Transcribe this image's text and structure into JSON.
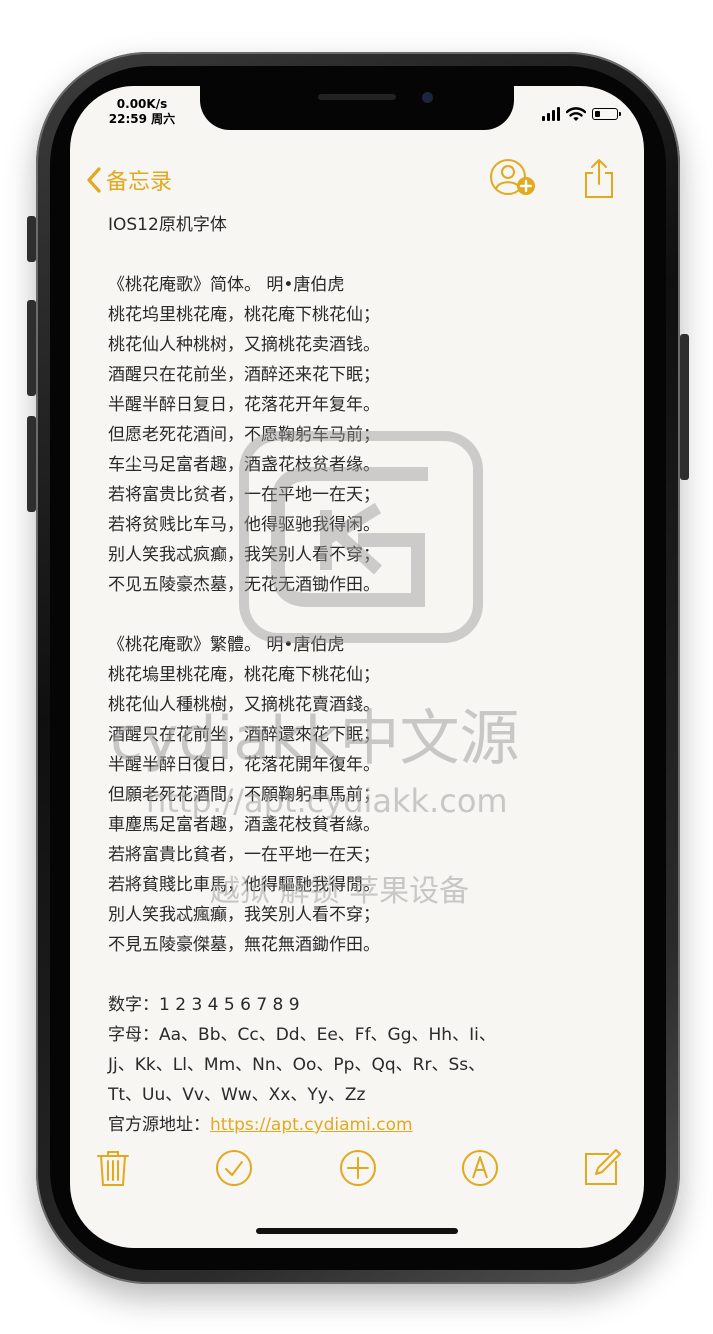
{
  "status_bar": {
    "network_speed": "0.00K/s",
    "time_day": "22:59 周六"
  },
  "nav": {
    "back_label": "备忘录",
    "icons": [
      "person-add-icon",
      "share-icon"
    ]
  },
  "note": {
    "title": "IOS12原机字体",
    "simplified": [
      "《桃花庵歌》简体。 明•唐伯虎",
      "桃花坞里桃花庵，桃花庵下桃花仙；",
      "桃花仙人种桃树，又摘桃花卖酒钱。",
      "酒醒只在花前坐，酒醉还来花下眠；",
      "半醒半醉日复日，花落花开年复年。",
      "但愿老死花酒间，不愿鞠躬车马前；",
      "车尘马足富者趣，酒盏花枝贫者缘。",
      "若将富贵比贫者，一在平地一在天；",
      "若将贫贱比车马，他得驱驰我得闲。",
      "别人笑我忒疯癫，我笑别人看不穿；",
      "不见五陵豪杰墓，无花无酒锄作田。"
    ],
    "traditional": [
      "《桃花庵歌》繁體。 明•唐伯虎",
      "桃花塢里桃花庵，桃花庵下桃花仙；",
      "桃花仙人種桃樹，又摘桃花賣酒錢。",
      "酒醒只在花前坐，酒醉還來花下眠；",
      "半醒半醉日復日，花落花開年復年。",
      "但願老死花酒間，不願鞠躬車馬前；",
      "車塵馬足富者趣，酒盞花枝貧者緣。",
      "若將富貴比貧者，一在平地一在天；",
      "若將貧賤比車馬，他得驅馳我得閒。",
      "別人笑我忒瘋癲，我笑別人看不穿；",
      "不見五陵豪傑墓，無花無酒鋤作田。"
    ],
    "digits_line": "数字：1 2 3 4 5 6 7 8 9",
    "letters_lines": [
      "字母：Aa、Bb、Cc、Dd、Ee、Ff、Gg、Hh、Ii、",
      "Jj、Kk、Ll、Mm、Nn、Oo、Pp、Qq、Rr、Ss、",
      "Tt、Uu、Vv、Ww、Xx、Yy、Zz"
    ],
    "source_label": "官方源地址：",
    "source_link": "https://apt.cydiami.com"
  },
  "toolbar": {
    "icons": [
      "trash-icon",
      "checklist-icon",
      "add-icon",
      "markup-icon",
      "compose-icon"
    ]
  },
  "watermark": {
    "brand": "cydiakk中文源",
    "url": "http://apt.cydiakk.com",
    "tagline": "越狱 解锁 苹果设备"
  },
  "colors": {
    "accent": "#e2a91f",
    "paper": "#f7f6f3",
    "text": "#2a2a2a"
  }
}
